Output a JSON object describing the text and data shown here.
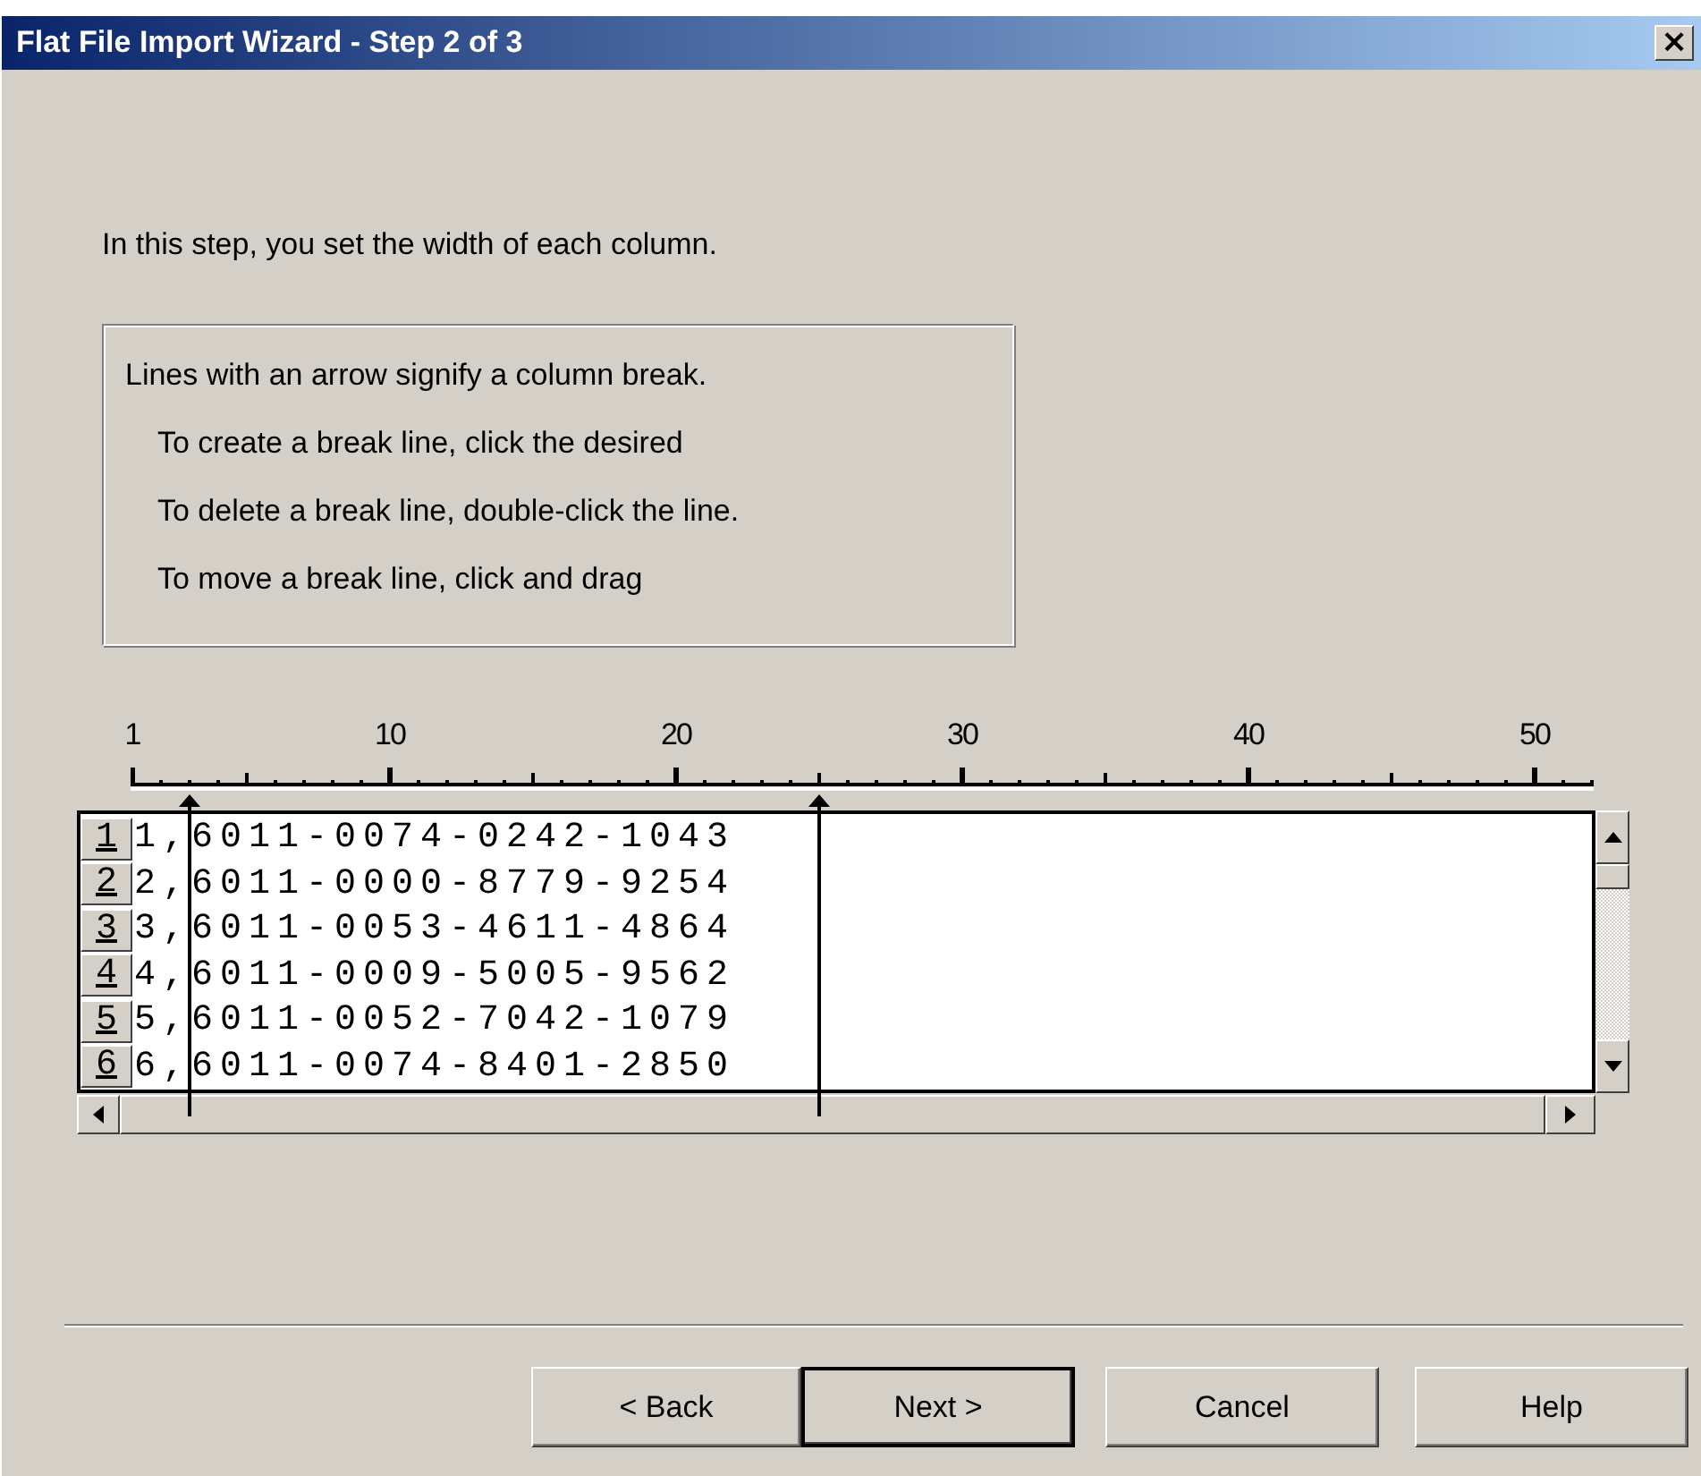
{
  "window": {
    "title": "Flat File Import Wizard - Step 2 of 3",
    "close": "×"
  },
  "intro": "In this step, you set the width of each column.",
  "instructions": {
    "heading": "Lines with an arrow signify a column break.",
    "lines": [
      "To create a break line, click the desired",
      "To delete a break line, double-click the line.",
      "To move a break line, click and drag"
    ]
  },
  "ruler": {
    "labels": [
      "1",
      "10",
      "20",
      "30",
      "40",
      "50"
    ],
    "breaks": [
      {
        "level": 0.039
      },
      {
        "level": 0.469
      }
    ]
  },
  "rows": [
    {
      "number": "1",
      "text": "1,6011-0074-0242-1043"
    },
    {
      "number": "2",
      "text": "2,6011-0000-8779-9254"
    },
    {
      "number": "3",
      "text": "3,6011-0053-4611-4864"
    },
    {
      "number": "4",
      "text": "4,6011-0009-5005-9562"
    },
    {
      "number": "5",
      "text": "5,6011-0052-7042-1079"
    },
    {
      "number": "6",
      "text": "6,6011-0074-8401-2850"
    }
  ],
  "buttons": [
    {
      "label": "< Back",
      "default": false
    },
    {
      "label": "Next >",
      "default": true
    },
    {
      "label": "Cancel",
      "default": false
    },
    {
      "label": "Help",
      "default": false
    }
  ]
}
